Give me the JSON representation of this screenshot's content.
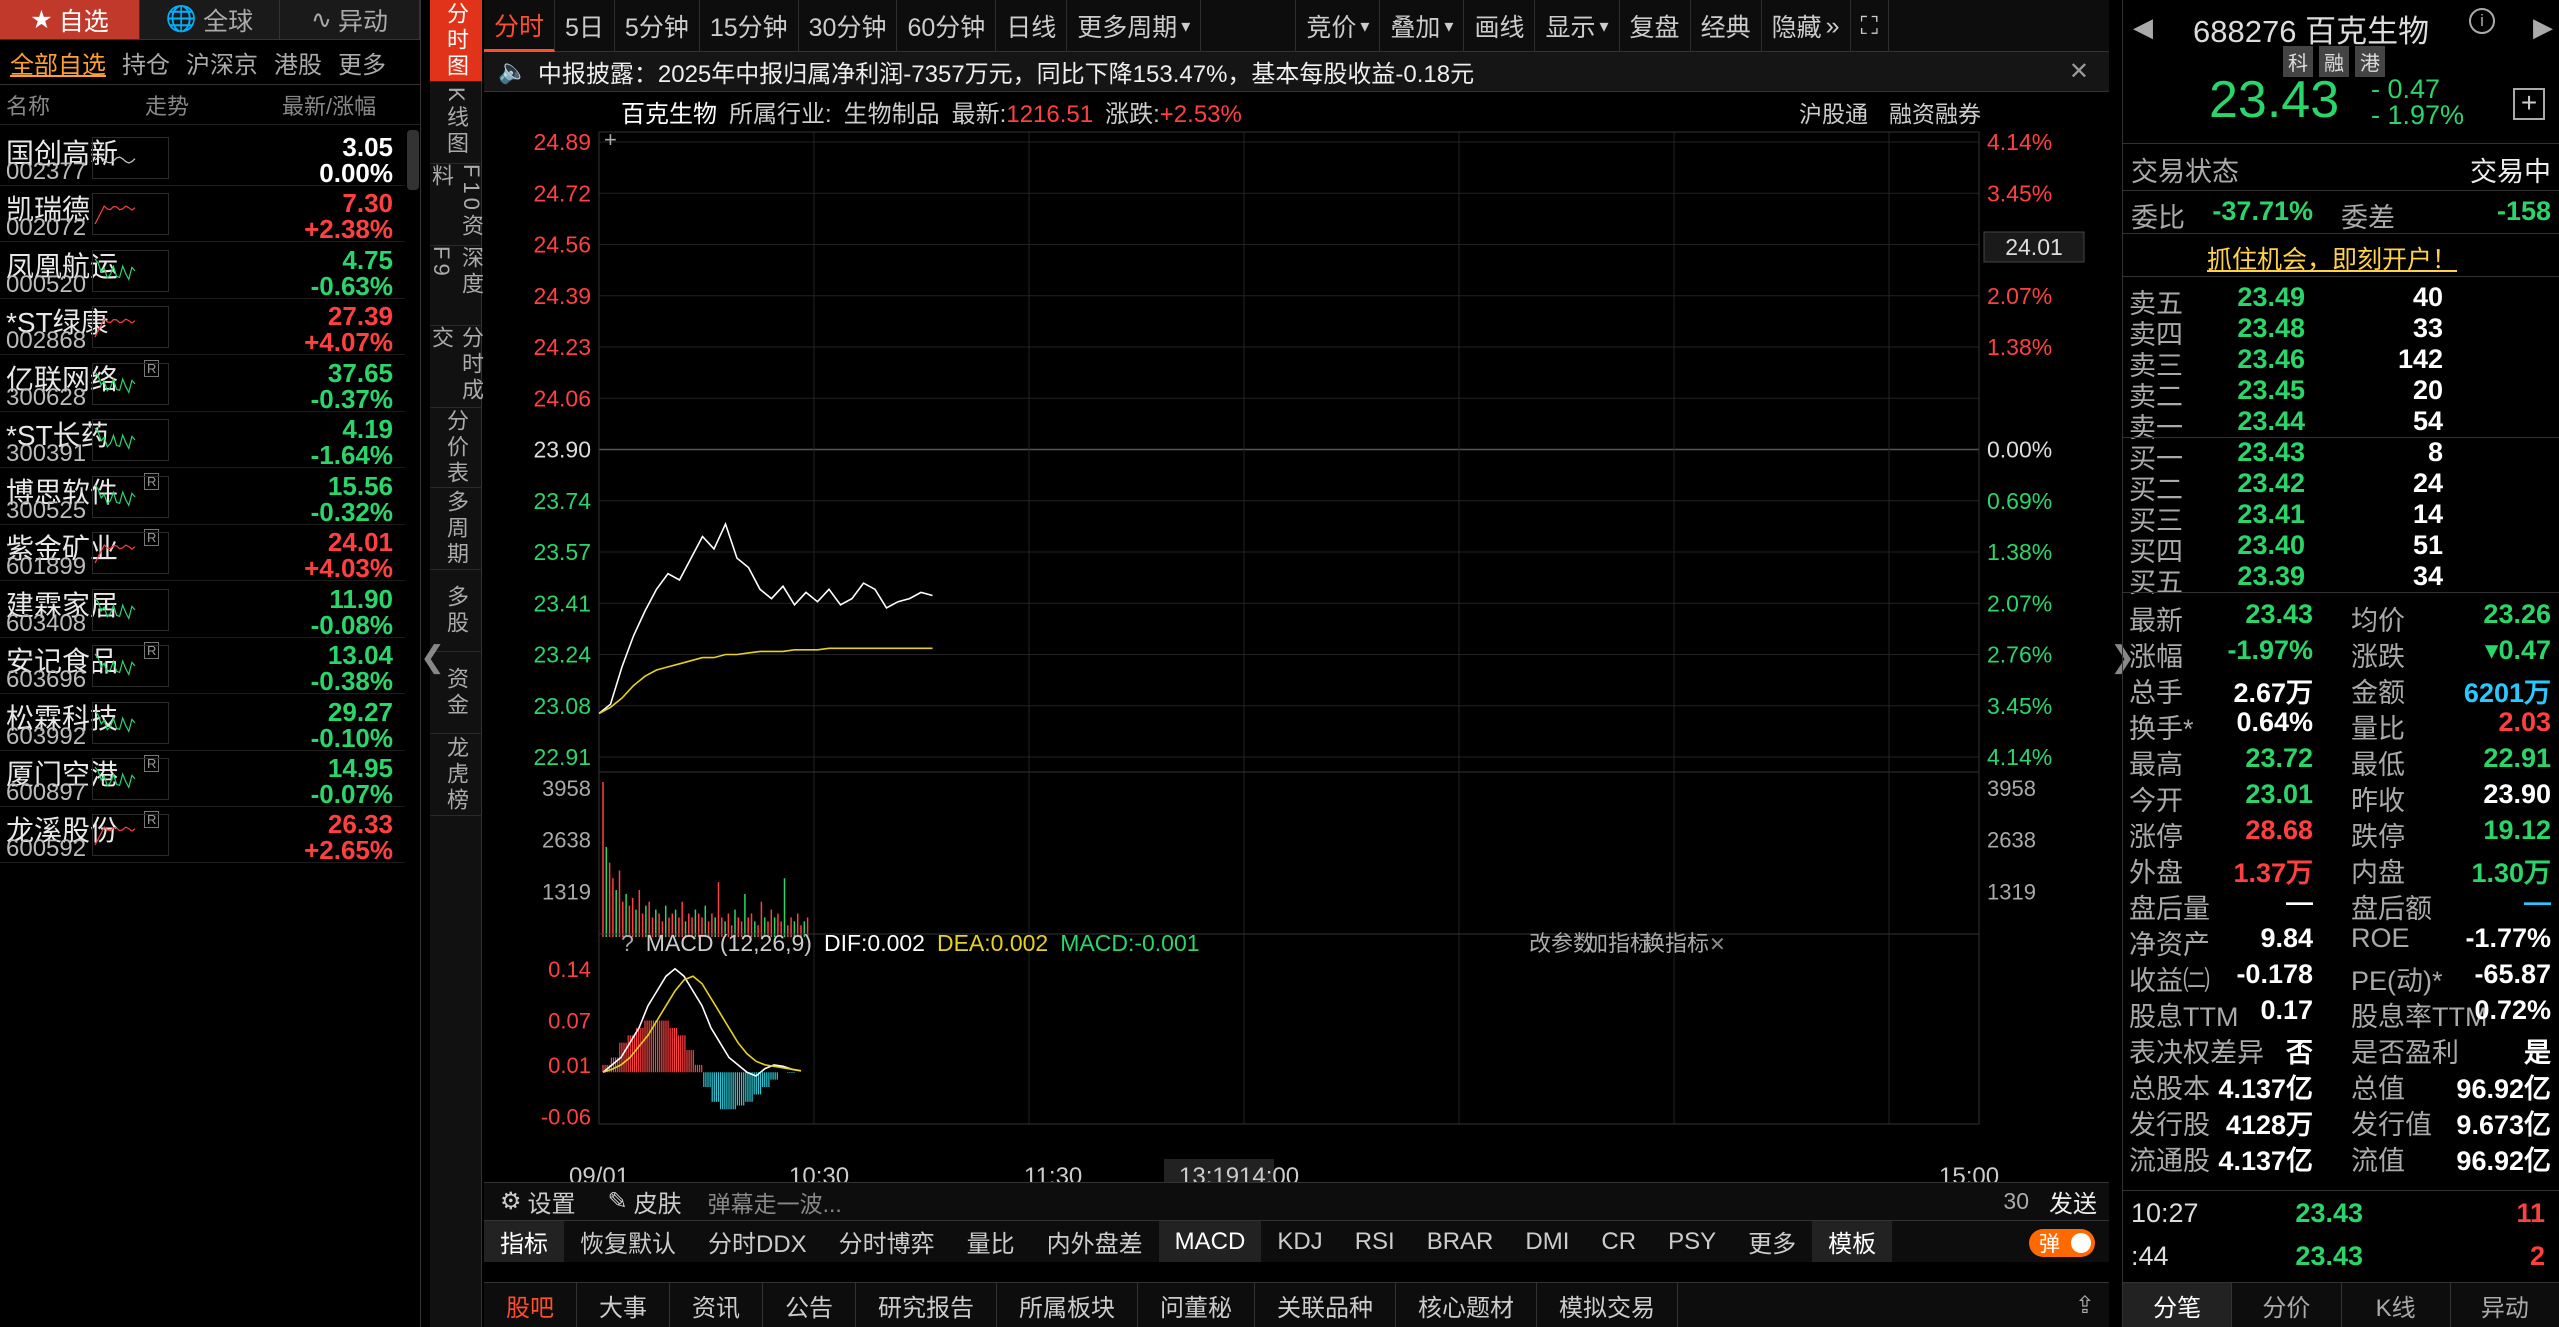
{
  "left": {
    "tabs": [
      "自选",
      "全球",
      "异动"
    ],
    "subtabs": [
      "全部自选",
      "持仓",
      "沪深京",
      "港股",
      "更多"
    ],
    "headers": [
      "名称",
      "走势",
      "最新/涨幅"
    ],
    "stocks": [
      {
        "name": "国创高新",
        "code": "002377",
        "price": "3.05",
        "pct": "0.00%",
        "dir": "flat",
        "r": false
      },
      {
        "name": "凯瑞德",
        "code": "002072",
        "price": "7.30",
        "pct": "+2.38%",
        "dir": "up",
        "r": false
      },
      {
        "name": "凤凰航运",
        "code": "000520",
        "price": "4.75",
        "pct": "-0.63%",
        "dir": "dn",
        "r": false
      },
      {
        "name": "*ST绿康",
        "code": "002868",
        "price": "27.39",
        "pct": "+4.07%",
        "dir": "up",
        "r": false
      },
      {
        "name": "亿联网络",
        "code": "300628",
        "price": "37.65",
        "pct": "-0.37%",
        "dir": "dn",
        "r": true
      },
      {
        "name": "*ST长药",
        "code": "300391",
        "price": "4.19",
        "pct": "-1.64%",
        "dir": "dn",
        "r": false
      },
      {
        "name": "博思软件",
        "code": "300525",
        "price": "15.56",
        "pct": "-0.32%",
        "dir": "dn",
        "r": true
      },
      {
        "name": "紫金矿业",
        "code": "601899",
        "price": "24.01",
        "pct": "+4.03%",
        "dir": "up",
        "r": true
      },
      {
        "name": "建霖家居",
        "code": "603408",
        "price": "11.90",
        "pct": "-0.08%",
        "dir": "dn",
        "r": false
      },
      {
        "name": "安记食品",
        "code": "603696",
        "price": "13.04",
        "pct": "-0.38%",
        "dir": "dn",
        "r": true
      },
      {
        "name": "松霖科技",
        "code": "603992",
        "price": "29.27",
        "pct": "-0.10%",
        "dir": "dn",
        "r": false
      },
      {
        "name": "厦门空港",
        "code": "600897",
        "price": "14.95",
        "pct": "-0.07%",
        "dir": "dn",
        "r": true
      },
      {
        "name": "龙溪股份",
        "code": "600592",
        "price": "26.33",
        "pct": "+2.65%",
        "dir": "up",
        "r": true
      }
    ]
  },
  "vtabs": [
    "分时图",
    "K线图",
    "F10资料",
    "深度F9",
    "分时成交",
    "分价表",
    "多周期",
    "多股",
    "资金",
    "龙虎榜"
  ],
  "toolbar": [
    "分时",
    "5日",
    "5分钟",
    "15分钟",
    "30分钟",
    "60分钟",
    "日线",
    "更多周期",
    "竞价",
    "叠加",
    "画线",
    "显示",
    "复盘",
    "经典",
    "隐藏"
  ],
  "notice": "中报披露：2025年中报归属净利润-7357万元，同比下降153.47%，基本每股收益-0.18元",
  "chart_info": {
    "name": "百克生物",
    "industry_label": "所属行业:",
    "industry": "生物制品",
    "latest_label": "最新:",
    "latest": "1216.51",
    "change_label": "涨跌:",
    "change": "+2.53%",
    "right_links": [
      "沪股通",
      "融资融券"
    ],
    "crosshair_value": "24.01",
    "cursor_time": "13:19"
  },
  "macd": {
    "title": "MACD (12,26,9)",
    "dif": "DIF:0.002",
    "dea": "DEA:0.002",
    "macd": "MACD:-0.001",
    "links": [
      "改参数",
      "加指标",
      "换指标"
    ]
  },
  "chart_data": [
    {
      "type": "line",
      "title": "",
      "x": [
        "09:30",
        "09:32",
        "09:34",
        "09:36",
        "09:38",
        "09:40",
        "09:42",
        "09:44",
        "09:46",
        "09:48",
        "09:50",
        "09:52",
        "09:54",
        "09:56",
        "09:58",
        "10:00",
        "10:02",
        "10:04",
        "10:06",
        "10:08",
        "10:10",
        "10:12",
        "10:14",
        "10:16",
        "10:18",
        "10:20",
        "10:22",
        "10:24",
        "10:26",
        "10:27"
      ],
      "series": [
        {
          "name": "价格",
          "values": [
            23.05,
            23.08,
            23.2,
            23.3,
            23.38,
            23.45,
            23.5,
            23.48,
            23.55,
            23.62,
            23.58,
            23.66,
            23.55,
            23.52,
            23.45,
            23.42,
            23.46,
            23.4,
            23.44,
            23.41,
            23.45,
            23.4,
            23.42,
            23.47,
            23.45,
            23.39,
            23.41,
            23.42,
            23.44,
            23.43
          ]
        },
        {
          "name": "均价",
          "values": [
            23.05,
            23.07,
            23.1,
            23.14,
            23.17,
            23.19,
            23.2,
            23.21,
            23.22,
            23.23,
            23.23,
            23.24,
            23.24,
            23.245,
            23.25,
            23.25,
            23.25,
            23.255,
            23.255,
            23.255,
            23.26,
            23.26,
            23.26,
            23.26,
            23.26,
            23.26,
            23.26,
            23.26,
            23.26,
            23.26
          ]
        }
      ],
      "ylim": [
        22.91,
        24.89
      ],
      "y_ticks": [
        "24.89",
        "24.72",
        "24.56",
        "24.39",
        "24.23",
        "24.06",
        "23.90",
        "23.74",
        "23.57",
        "23.41",
        "23.24",
        "23.08",
        "22.91"
      ],
      "pct_ticks": [
        "4.14%",
        "3.45%",
        "2.76%",
        "2.07%",
        "1.38%",
        "",
        "0.00%",
        "0.69%",
        "1.38%",
        "2.07%",
        "2.76%",
        "3.45%",
        "4.14%"
      ],
      "x_labels": [
        "09/01",
        "10:30",
        "11:30",
        "13:19",
        "14:00",
        "15:00"
      ]
    },
    {
      "type": "bar",
      "title": "",
      "y_ticks": [
        "3958",
        "2638",
        "1319"
      ],
      "ylim": [
        0,
        3958
      ],
      "values": [
        3958,
        2300,
        1900,
        1500,
        1200,
        1700,
        900,
        1100,
        800,
        1000,
        700,
        1200,
        600,
        800,
        900,
        500,
        700,
        600,
        400,
        800,
        500,
        600,
        700,
        500,
        900,
        400,
        600,
        500,
        700,
        600,
        500,
        800,
        400,
        600,
        500,
        1400,
        500,
        400,
        600,
        300,
        700,
        500,
        400,
        1100,
        500,
        600,
        400,
        300,
        900,
        500,
        400,
        700,
        500,
        600,
        400,
        1500,
        300,
        500,
        400,
        600,
        300,
        400,
        500
      ]
    },
    {
      "type": "line",
      "title": "",
      "y_ticks": [
        "0.14",
        "0.07",
        "0.01",
        "-0.06"
      ],
      "ylim": [
        -0.07,
        0.16
      ],
      "series": [
        {
          "name": "DIF",
          "values": [
            0.0,
            0.01,
            0.02,
            0.04,
            0.06,
            0.09,
            0.11,
            0.13,
            0.14,
            0.13,
            0.11,
            0.09,
            0.06,
            0.04,
            0.02,
            0.01,
            0.0,
            -0.005,
            0.005,
            0.01,
            0.008,
            0.004,
            0.002
          ]
        },
        {
          "name": "DEA",
          "values": [
            0.0,
            0.004,
            0.01,
            0.02,
            0.035,
            0.05,
            0.07,
            0.09,
            0.11,
            0.125,
            0.13,
            0.12,
            0.1,
            0.08,
            0.06,
            0.04,
            0.025,
            0.015,
            0.01,
            0.008,
            0.006,
            0.004,
            0.002
          ]
        }
      ],
      "bars": [
        0.01,
        0.02,
        0.04,
        0.05,
        0.06,
        0.07,
        0.07,
        0.07,
        0.06,
        0.05,
        0.03,
        0.01,
        -0.02,
        -0.04,
        -0.05,
        -0.05,
        -0.045,
        -0.04,
        -0.03,
        -0.02,
        -0.01,
        0.0,
        -0.001
      ]
    }
  ],
  "bottom_tools": {
    "settings": "设置",
    "skin": "皮肤",
    "danmu_placeholder": "弹幕走一波...",
    "count": "30",
    "send": "发送"
  },
  "indicator_tabs": [
    "指标",
    "恢复默认",
    "分时DDX",
    "分时博弈",
    "量比",
    "内外盘差",
    "MACD",
    "KDJ",
    "RSI",
    "BRAR",
    "DMI",
    "CR",
    "PSY",
    "更多",
    "模板"
  ],
  "danmu_toggle": "弹",
  "news_tabs": [
    "股吧",
    "大事",
    "资讯",
    "公告",
    "研究报告",
    "所属板块",
    "问董秘",
    "关联品种",
    "核心题材",
    "模拟交易"
  ],
  "right": {
    "code": "688276",
    "name": "百克生物",
    "badges": [
      "科",
      "融",
      "港"
    ],
    "price": "23.43",
    "change": "- 0.47",
    "change_pct": "- 1.97%",
    "trade_status_label": "交易状态",
    "trade_status": "交易中",
    "weibi_label": "委比",
    "weibi": "-37.71%",
    "weicha_label": "委差",
    "weicha": "-158",
    "promo": "抓住机会，即刻开户！",
    "asks": [
      {
        "label": "卖五",
        "price": "23.49",
        "vol": "40"
      },
      {
        "label": "卖四",
        "price": "23.48",
        "vol": "33"
      },
      {
        "label": "卖三",
        "price": "23.46",
        "vol": "142"
      },
      {
        "label": "卖二",
        "price": "23.45",
        "vol": "20"
      },
      {
        "label": "卖一",
        "price": "23.44",
        "vol": "54"
      }
    ],
    "bids": [
      {
        "label": "买一",
        "price": "23.43",
        "vol": "8"
      },
      {
        "label": "买二",
        "price": "23.42",
        "vol": "24"
      },
      {
        "label": "买三",
        "price": "23.41",
        "vol": "14"
      },
      {
        "label": "买四",
        "price": "23.40",
        "vol": "51"
      },
      {
        "label": "买五",
        "price": "23.39",
        "vol": "34"
      }
    ],
    "stats": [
      {
        "l1": "最新",
        "v1": "23.43",
        "c1": "dn",
        "l2": "均价",
        "v2": "23.26",
        "c2": "dn"
      },
      {
        "l1": "涨幅",
        "v1": "-1.97%",
        "c1": "dn",
        "l2": "涨跌",
        "v2": "▾0.47",
        "c2": "dn"
      },
      {
        "l1": "总手",
        "v1": "2.67万",
        "c1": "wh",
        "l2": "金额",
        "v2": "6201万",
        "c2": "cy"
      },
      {
        "l1": "换手*",
        "v1": "0.64%",
        "c1": "wh",
        "l2": "量比",
        "v2": "2.03",
        "c2": "up"
      },
      {
        "l1": "最高",
        "v1": "23.72",
        "c1": "dn",
        "l2": "最低",
        "v2": "22.91",
        "c2": "dn"
      },
      {
        "l1": "今开",
        "v1": "23.01",
        "c1": "dn",
        "l2": "昨收",
        "v2": "23.90",
        "c2": "wh"
      },
      {
        "l1": "涨停",
        "v1": "28.68",
        "c1": "up",
        "l2": "跌停",
        "v2": "19.12",
        "c2": "dn"
      },
      {
        "l1": "外盘",
        "v1": "1.37万",
        "c1": "up",
        "l2": "内盘",
        "v2": "1.30万",
        "c2": "dn"
      },
      {
        "l1": "盘后量",
        "v1": "—",
        "c1": "wh",
        "l2": "盘后额",
        "v2": "—",
        "c2": "cy"
      },
      {
        "l1": "净资产",
        "v1": "9.84",
        "c1": "wh",
        "l2": "ROE",
        "v2": "-1.77%",
        "c2": "wh"
      },
      {
        "l1": "收益㈡",
        "v1": "-0.178",
        "c1": "wh",
        "l2": "PE(动)*",
        "v2": "-65.87",
        "c2": "wh"
      },
      {
        "l1": "股息TTM",
        "v1": "0.17",
        "c1": "wh",
        "l2": "股息率TTM",
        "v2": "0.72%",
        "c2": "wh"
      },
      {
        "l1": "表决权差异",
        "v1": "否",
        "c1": "wh",
        "l2": "是否盈利",
        "v2": "是",
        "c2": "wh"
      },
      {
        "l1": "总股本",
        "v1": "4.137亿",
        "c1": "wh",
        "l2": "总值",
        "v2": "96.92亿",
        "c2": "wh"
      },
      {
        "l1": "发行股",
        "v1": "4128万",
        "c1": "wh",
        "l2": "发行值",
        "v2": "9.673亿",
        "c2": "wh"
      },
      {
        "l1": "流通股",
        "v1": "4.137亿",
        "c1": "wh",
        "l2": "流值",
        "v2": "96.92亿",
        "c2": "wh"
      }
    ],
    "ticks": [
      {
        "time": "10:27",
        "price": "23.43",
        "vol": "11"
      },
      {
        "time": ":44",
        "price": "23.43",
        "vol": "2"
      }
    ],
    "bottom_tabs": [
      "分笔",
      "分价",
      "K线",
      "异动"
    ]
  },
  "colors": {
    "up": "#ff4040",
    "down": "#2ad66a",
    "price_line": "#ffffff",
    "avg_line": "#e6d21c",
    "accent": "#e0331a"
  }
}
